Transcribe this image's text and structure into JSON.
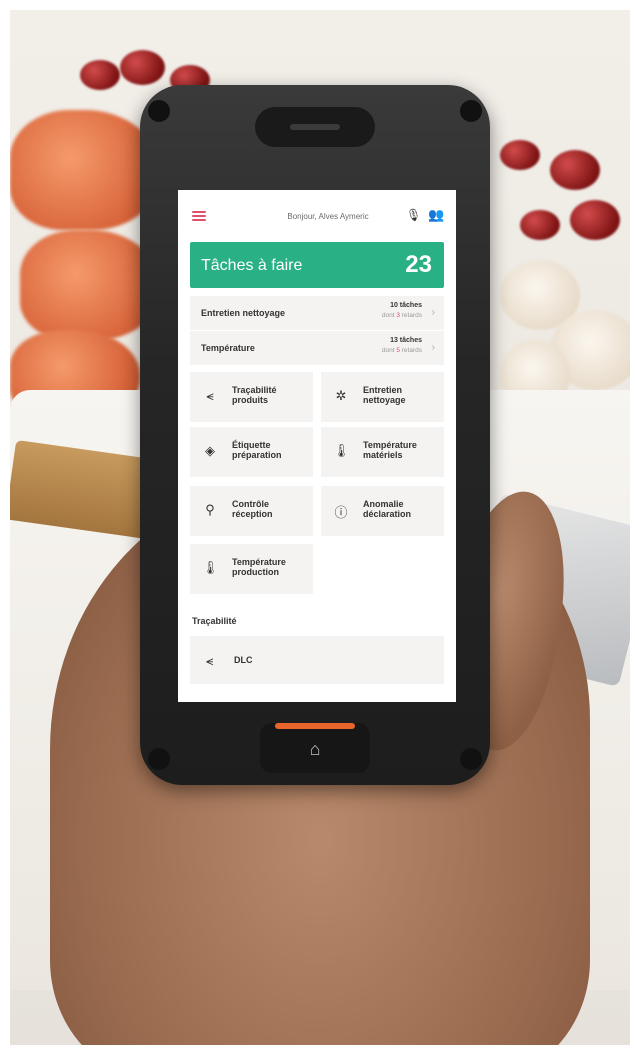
{
  "header": {
    "greeting": "Bonjour, Alves Aymeric",
    "menu_icon": "hamburger-menu-icon",
    "mic_icon": "microphone-icon",
    "users_icon": "users-icon"
  },
  "tasks": {
    "title": "Tâches à faire",
    "count": "23",
    "accent_color": "#29b084",
    "rows": [
      {
        "label": "Entretien nettoyage",
        "count": "10 tâches",
        "sub_prefix": "dont ",
        "late_number": "3",
        "sub_suffix": " retards"
      },
      {
        "label": "Température",
        "count": "13 tâches",
        "sub_prefix": "dont ",
        "late_number": "5",
        "sub_suffix": " retards"
      }
    ]
  },
  "tiles": [
    {
      "line1": "Traçabilité",
      "line2": "produits",
      "icon": "share-icon"
    },
    {
      "line1": "Entretien",
      "line2": "nettoyage",
      "icon": "spray-icon"
    },
    {
      "line1": "Étiquette",
      "line2": "préparation",
      "icon": "tag-icon"
    },
    {
      "line1": "Température",
      "line2": "matériels",
      "icon": "thermometer-icon"
    },
    {
      "line1": "Contrôle",
      "line2": "réception",
      "icon": "search-icon"
    },
    {
      "line1": "Anomalie",
      "line2": "déclaration",
      "icon": "alert-icon"
    },
    {
      "line1": "Température",
      "line2": "production",
      "icon": "thermometer-icon"
    }
  ],
  "traceability": {
    "section_title": "Traçabilité",
    "dlc_label": "DLC",
    "dlc_icon": "share-icon"
  },
  "late_color": "#e0506a"
}
